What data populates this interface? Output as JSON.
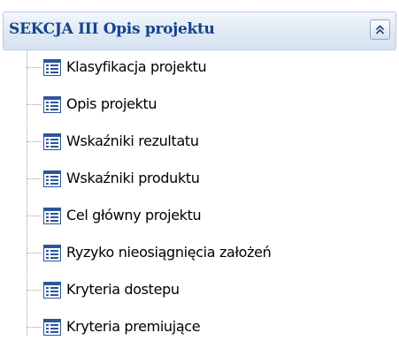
{
  "section": {
    "title": "SEKCJA III Opis projektu",
    "collapse_icon": "double-chevron-up-icon"
  },
  "tree": {
    "item_icon": "form-document-icon",
    "items": [
      {
        "label": "Klasyfikacja projektu"
      },
      {
        "label": "Opis projektu"
      },
      {
        "label": "Wskaźniki rezultatu"
      },
      {
        "label": "Wskaźniki produktu"
      },
      {
        "label": "Cel główny projektu"
      },
      {
        "label": "Ryzyko nieosiągnięcia założeń"
      },
      {
        "label": "Kryteria dostepu"
      },
      {
        "label": "Kryteria premiujące"
      }
    ]
  },
  "colors": {
    "header_text": "#15428b",
    "header_border": "#b9cbe3",
    "icon_fill": "#2b5797"
  }
}
